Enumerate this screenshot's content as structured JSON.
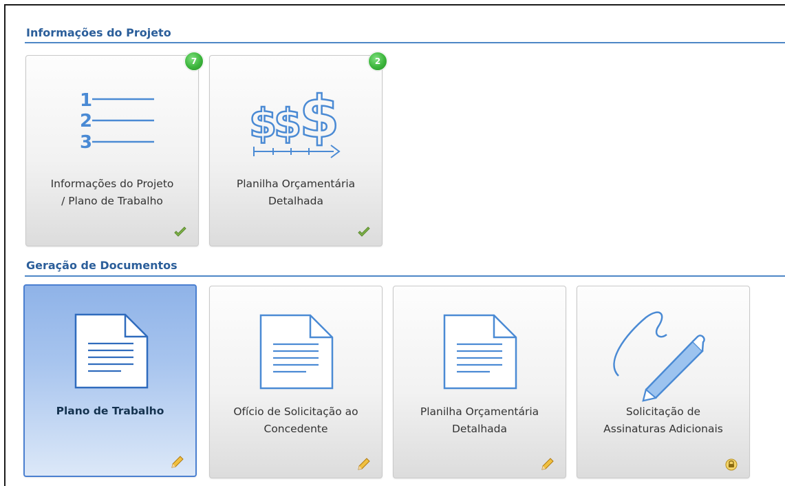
{
  "sections": [
    {
      "title": "Informações do Projeto",
      "tiles": [
        {
          "label_line1": "Informações do Projeto",
          "label_line2": "/ Plano de Trabalho",
          "badge": "7",
          "status": "check",
          "icon": "numbered-list-icon"
        },
        {
          "label_line1": "Planilha Orçamentária",
          "label_line2": "Detalhada",
          "badge": "2",
          "status": "check",
          "icon": "budget-dollar-icon"
        }
      ]
    },
    {
      "title": "Geração de Documentos",
      "tiles": [
        {
          "label_line1": "Plano de Trabalho",
          "label_line2": "",
          "status": "pencil",
          "icon": "document-icon",
          "active": true
        },
        {
          "label_line1": "Ofício de Solicitação ao",
          "label_line2": "Concedente",
          "status": "pencil",
          "icon": "document-icon"
        },
        {
          "label_line1": "Planilha Orçamentária",
          "label_line2": "Detalhada",
          "status": "pencil",
          "icon": "document-icon"
        },
        {
          "label_line1": "Solicitação de",
          "label_line2": "Assinaturas Adicionais",
          "status": "lock",
          "icon": "signature-pen-icon"
        }
      ]
    }
  ],
  "colors": {
    "section_title": "#2b5e9a",
    "section_line": "#4d86c6",
    "icon_blue": "#4a8ad4",
    "badge_green": "#3cb53c",
    "active_tile": "#8fb3e8"
  }
}
